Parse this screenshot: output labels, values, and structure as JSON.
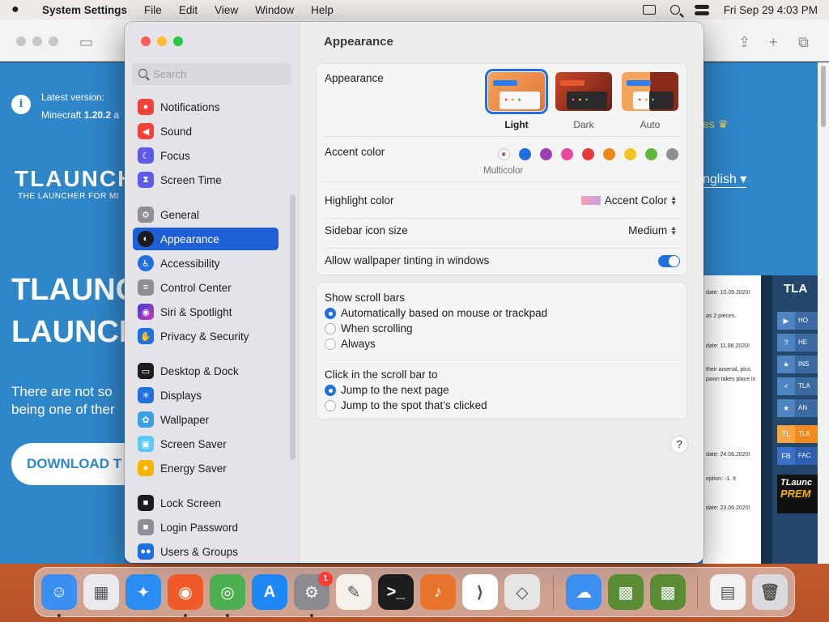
{
  "menubar": {
    "app_name": "System Settings",
    "menus": [
      "File",
      "Edit",
      "View",
      "Window",
      "Help"
    ],
    "clock": "Fri Sep 29  4:03 PM"
  },
  "browser_page": {
    "latest_label": "Latest version:",
    "latest_value_prefix": "Minecraft ",
    "latest_value": "1.20.2",
    "latest_value_suffix": " a",
    "logo": "TLAUNCH",
    "logo_sub": "THE LAUNCHER FOR MI",
    "hero_line1": "TLAUNC",
    "hero_line2": "LAUNCH",
    "hero_text1": "There are not so",
    "hero_text2": "being one of ther",
    "download_button": "DOWNLOAD T",
    "language": "nglish",
    "gold_text": "es",
    "news_lines": [
      "date: 10.09.2020!",
      "as 2 pieces.",
      "date: 11.08.2020!",
      "their arsenal, plus",
      "pawn takes place in",
      "date: 24.06.2020!",
      "eption: -1. It",
      "date: 23.06.2020!"
    ],
    "side_items": [
      {
        "icon": "▶",
        "label": "HO"
      },
      {
        "icon": "?",
        "label": "HE"
      },
      {
        "icon": "★",
        "label": "INS"
      },
      {
        "icon": "<",
        "label": "TLA"
      },
      {
        "icon": "★",
        "label": "AN"
      },
      {
        "icon": "TL",
        "label": "TLA"
      },
      {
        "icon": "FB",
        "label": "FAC"
      }
    ],
    "premium_label": "TLaunc",
    "premium_sub": "PREM"
  },
  "sidebar": {
    "search_placeholder": "Search",
    "items": [
      {
        "label": "Notifications",
        "icon": "bell-icon",
        "color": "#f0433a",
        "glyph": "●"
      },
      {
        "label": "Sound",
        "icon": "speaker-icon",
        "color": "#f0433a",
        "glyph": "◀"
      },
      {
        "label": "Focus",
        "icon": "moon-icon",
        "color": "#5e5ce6",
        "glyph": "☾"
      },
      {
        "label": "Screen Time",
        "icon": "hourglass-icon",
        "color": "#5e5ce6",
        "glyph": "⧗"
      },
      {
        "label": "General",
        "icon": "gear-icon",
        "color": "#8e8e93",
        "glyph": "⚙"
      },
      {
        "label": "Appearance",
        "icon": "appearance-icon",
        "color": "#1c1c1e",
        "glyph": "◐"
      },
      {
        "label": "Accessibility",
        "icon": "accessibility-icon",
        "color": "#1f6fe0",
        "glyph": "♿"
      },
      {
        "label": "Control Center",
        "icon": "toggles-icon",
        "color": "#8e8e93",
        "glyph": "≡"
      },
      {
        "label": "Siri & Spotlight",
        "icon": "siri-icon",
        "color": "#b23cc7",
        "glyph": "◉"
      },
      {
        "label": "Privacy & Security",
        "icon": "hand-icon",
        "color": "#1f6fe0",
        "glyph": "✋"
      },
      {
        "label": "Desktop & Dock",
        "icon": "dock-icon",
        "color": "#1c1c1e",
        "glyph": "▭"
      },
      {
        "label": "Displays",
        "icon": "sun-icon",
        "color": "#1f6fe0",
        "glyph": "☀"
      },
      {
        "label": "Wallpaper",
        "icon": "flower-icon",
        "color": "#3aa0e8",
        "glyph": "✿"
      },
      {
        "label": "Screen Saver",
        "icon": "screensaver-icon",
        "color": "#5ac8fa",
        "glyph": "▣"
      },
      {
        "label": "Energy Saver",
        "icon": "bulb-icon",
        "color": "#f7b500",
        "glyph": "💡"
      },
      {
        "label": "Lock Screen",
        "icon": "lock-icon",
        "color": "#1c1c1e",
        "glyph": "🔒"
      },
      {
        "label": "Login Password",
        "icon": "padlock-icon",
        "color": "#8e8e93",
        "glyph": "🔒"
      },
      {
        "label": "Users & Groups",
        "icon": "users-icon",
        "color": "#1f6fe0",
        "glyph": "👥"
      }
    ],
    "active": "Appearance"
  },
  "content": {
    "title": "Appearance",
    "appearance": {
      "label": "Appearance",
      "options": [
        "Light",
        "Dark",
        "Auto"
      ],
      "selected": "Light"
    },
    "accent": {
      "label": "Accent color",
      "caption": "Multicolor",
      "colors": [
        "#1f6fe0",
        "#9b3fb6",
        "#e8479d",
        "#e5393b",
        "#f0861c",
        "#f5c120",
        "#5fb83b",
        "#8e8e93"
      ]
    },
    "highlight": {
      "label": "Highlight color",
      "value": "Accent Color"
    },
    "sidebar_icon_size": {
      "label": "Sidebar icon size",
      "value": "Medium"
    },
    "wallpaper_tinting": {
      "label": "Allow wallpaper tinting in windows",
      "on": true
    },
    "scroll_bars": {
      "label": "Show scroll bars",
      "options": [
        "Automatically based on mouse or trackpad",
        "When scrolling",
        "Always"
      ],
      "selected": 0
    },
    "click_scroll": {
      "label": "Click in the scroll bar to",
      "options": [
        "Jump to the next page",
        "Jump to the spot that’s clicked"
      ],
      "selected": 0
    },
    "help": "?"
  },
  "dock": {
    "items": [
      {
        "name": "finder-icon",
        "color": "#3b8ff0",
        "glyph": "☺"
      },
      {
        "name": "launchpad-icon",
        "color": "#e9e9ee",
        "glyph": "▦"
      },
      {
        "name": "safari-icon",
        "color": "#2a8df2",
        "glyph": "✦"
      },
      {
        "name": "firefox-icon",
        "color": "#f05a28",
        "glyph": "◉"
      },
      {
        "name": "chrome-icon",
        "color": "#4caf50",
        "glyph": "◎"
      },
      {
        "name": "app-store-icon",
        "color": "#1e88f5",
        "glyph": "A"
      },
      {
        "name": "system-settings-icon",
        "color": "#8a8a8f",
        "glyph": "⚙"
      },
      {
        "name": "textedit-icon",
        "color": "#f4f1ea",
        "glyph": "✎"
      },
      {
        "name": "terminal-icon",
        "color": "#1d1d1f",
        "glyph": ">_"
      },
      {
        "name": "garageband-icon",
        "color": "#e9742b",
        "glyph": "♪"
      },
      {
        "name": "vscode-icon",
        "color": "#ffffff",
        "glyph": "⟩"
      },
      {
        "name": "roblox-icon",
        "color": "#e5e5e5",
        "glyph": "◇"
      },
      {
        "name": "weather-icon",
        "color": "#3d8ff0",
        "glyph": "☁"
      },
      {
        "name": "minecraft-icon",
        "color": "#5a8c34",
        "glyph": "▩"
      },
      {
        "name": "minecraft-launcher-icon",
        "color": "#5a8c34",
        "glyph": "▩"
      },
      {
        "name": "recent-document-icon",
        "color": "#f2f2f2",
        "glyph": "▤"
      },
      {
        "name": "trash-icon",
        "color": "#dadadf",
        "glyph": "🗑"
      }
    ],
    "settings_badge": "1"
  }
}
